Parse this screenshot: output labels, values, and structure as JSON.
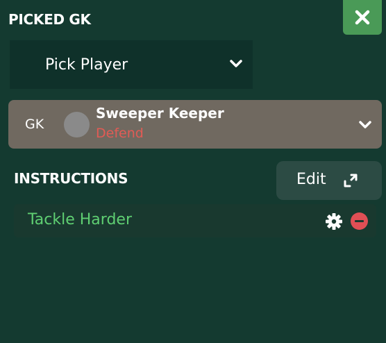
{
  "panel": {
    "title": "PICKED GK"
  },
  "close_button": {
    "icon": "close-icon",
    "color": "#4a9a57"
  },
  "player_select": {
    "label": "Pick Player",
    "icon": "chevron-down-icon"
  },
  "role": {
    "position": "GK",
    "name": "Sweeper Keeper",
    "duty": "Defend",
    "duty_color": "#e25b55",
    "card_color": "#706960",
    "icon": "chevron-down-icon"
  },
  "instructions": {
    "title": "INSTRUCTIONS",
    "edit_label": "Edit",
    "edit_icon": "expand-icon",
    "items": [
      {
        "label": "Tackle Harder",
        "color": "#5fcf72",
        "settings_icon": "gear-icon",
        "remove_icon": "remove-icon"
      }
    ]
  }
}
